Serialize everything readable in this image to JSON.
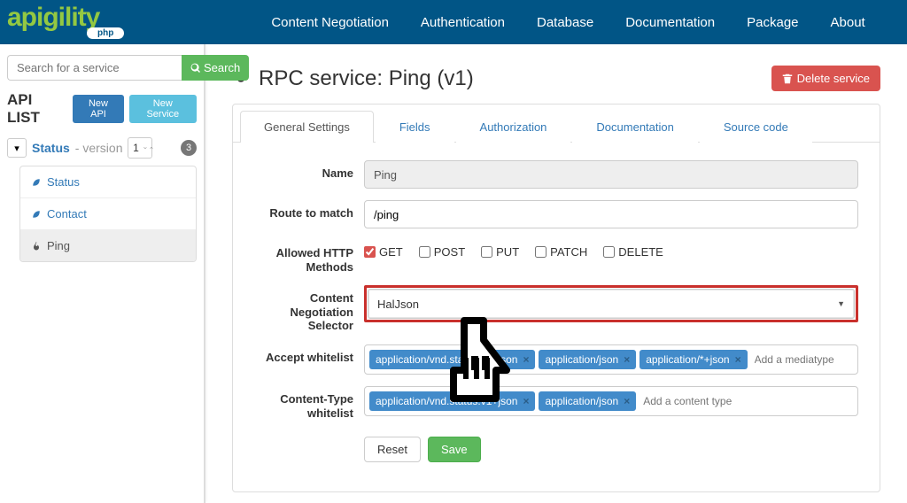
{
  "nav": {
    "items": [
      "Content Negotiation",
      "Authentication",
      "Database",
      "Documentation",
      "Package",
      "About"
    ]
  },
  "sidebar": {
    "search_placeholder": "Search for a service",
    "search_button": "Search",
    "apilist_title": "API LIST",
    "new_api_btn": "New API",
    "new_service_btn": "New Service",
    "api": {
      "name": "Status",
      "version_label": "- version",
      "version_value": "1",
      "service_count": "3",
      "services": [
        "Status",
        "Contact",
        "Ping"
      ],
      "active_index": 2
    }
  },
  "main": {
    "title": "RPC service: Ping (v1)",
    "delete_btn": "Delete service",
    "tabs": [
      "General Settings",
      "Fields",
      "Authorization",
      "Documentation",
      "Source code"
    ],
    "active_tab": 0,
    "form": {
      "name_label": "Name",
      "name_value": "Ping",
      "route_label": "Route to match",
      "route_value": "/ping",
      "methods_label": "Allowed HTTP Methods",
      "methods": [
        {
          "name": "GET",
          "checked": true
        },
        {
          "name": "POST",
          "checked": false
        },
        {
          "name": "PUT",
          "checked": false
        },
        {
          "name": "PATCH",
          "checked": false
        },
        {
          "name": "DELETE",
          "checked": false
        }
      ],
      "cn_label": "Content Negotiation Selector",
      "cn_value": "HalJson",
      "accept_label": "Accept whitelist",
      "accept_tags": [
        "application/vnd.status.v1+json",
        "application/json",
        "application/*+json"
      ],
      "accept_placeholder": "Add a mediatype",
      "ct_label": "Content-Type whitelist",
      "ct_tags": [
        "application/vnd.status.v1+json",
        "application/json"
      ],
      "ct_placeholder": "Add a content type",
      "reset_btn": "Reset",
      "save_btn": "Save"
    }
  }
}
